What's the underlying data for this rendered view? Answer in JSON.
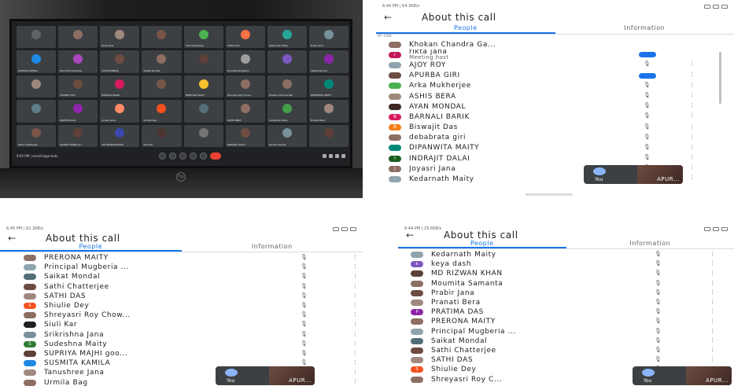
{
  "laptop": {
    "tiles": [
      {
        "name": "",
        "color": "#5f6368"
      },
      {
        "name": "",
        "color": "#8d6e63"
      },
      {
        "name": "Rikta Jana",
        "color": "#a1887f"
      },
      {
        "name": "",
        "color": "#795548"
      },
      {
        "name": "Arka Mukherjee",
        "color": "#4caf50"
      },
      {
        "name": "SATHI DAS",
        "color": "#ff7043"
      },
      {
        "name": "Kedarnath Maity",
        "color": "#26a69a"
      },
      {
        "name": "Prabir Jana",
        "color": "#78909c"
      },
      {
        "name": "SUSMITA KAMILA",
        "color": "#1e88e5"
      },
      {
        "name": "Moumita Samanta",
        "color": "#ab47bc"
      },
      {
        "name": "AYAN MONDAL",
        "color": "#6d4c41"
      },
      {
        "name": "Saikat Mondal",
        "color": "#8d6e63"
      },
      {
        "name": "",
        "color": "#5d4037"
      },
      {
        "name": "Principal Mugberia",
        "color": "#9e9e9e"
      },
      {
        "name": "",
        "color": "#7e57c2"
      },
      {
        "name": "debabrata giri",
        "color": "#8e24aa"
      },
      {
        "name": "",
        "color": "#a1887f"
      },
      {
        "name": "TONMOY DEY",
        "color": "#6d4c41"
      },
      {
        "name": "BARNALI BARIK",
        "color": "#d81b60"
      },
      {
        "name": "",
        "color": "#795548"
      },
      {
        "name": "PRERONA MAITY",
        "color": "#fbc02d"
      },
      {
        "name": "Shreyasri Roy Chow...",
        "color": "#8d6e63"
      },
      {
        "name": "Khokan Chandra Ba...",
        "color": "#8d6e63"
      },
      {
        "name": "DIPANWITA MAITY",
        "color": "#00897b"
      },
      {
        "name": "",
        "color": "#607d8b"
      },
      {
        "name": "PRATIMA DAS",
        "color": "#8e24aa"
      },
      {
        "name": "Joyasri Jana",
        "color": "#ff8a65"
      },
      {
        "name": "Shiulie Dey",
        "color": "#f4511e"
      },
      {
        "name": "",
        "color": "#546e7a"
      },
      {
        "name": "ASHIS BERA",
        "color": "#8d6e63"
      },
      {
        "name": "Sudeshna Maity",
        "color": "#43a047"
      },
      {
        "name": "Pranati Bera",
        "color": "#a1887f"
      },
      {
        "name": "Sathi Chatterjee",
        "color": "#795548"
      },
      {
        "name": "SUPRIYA MAJHI go...",
        "color": "#5d4037"
      },
      {
        "name": "MD RIZWAN KHAN",
        "color": "#3949ab"
      },
      {
        "name": "Siuli Kar",
        "color": "#4e342e"
      },
      {
        "name": "",
        "color": "#757575"
      },
      {
        "name": "INDRAJIT DALAI",
        "color": "#6d4c41"
      },
      {
        "name": "Tanusri Manna",
        "color": "#78909c"
      },
      {
        "name": "",
        "color": "#5d4037"
      }
    ],
    "time": "9:05 PM | email-kaga-todo",
    "brand": "hp"
  },
  "panel_a": {
    "status_time": "6:44 PM | 64.3KB/s",
    "title": "About this call",
    "tab_people": "People",
    "tab_info": "Information",
    "section": "In call",
    "rows": [
      {
        "name": "Khokan Chandra Ga...",
        "sub": "",
        "color": "#8d6e63",
        "letter": ""
      },
      {
        "name": "rikta jana",
        "sub": "Meeting host",
        "color": "#c2185b",
        "letter": "r"
      },
      {
        "name": "AJOY ROY",
        "sub": "",
        "color": "#90a4ae",
        "letter": ""
      },
      {
        "name": "APURBA GIRI",
        "sub": "",
        "color": "#6d4c41",
        "letter": ""
      },
      {
        "name": "Arka Mukherjee",
        "sub": "",
        "color": "#4caf50",
        "letter": ""
      },
      {
        "name": "ASHIS BERA",
        "sub": "",
        "color": "#a1887f",
        "letter": ""
      },
      {
        "name": "AYAN MONDAL",
        "sub": "",
        "color": "#3e2723",
        "letter": ""
      },
      {
        "name": "BARNALI BARIK",
        "sub": "",
        "color": "#d81b60",
        "letter": "B"
      },
      {
        "name": "Biswajit Das",
        "sub": "",
        "color": "#f57f17",
        "letter": "B"
      },
      {
        "name": "debabrata giri",
        "sub": "",
        "color": "#8d6e63",
        "letter": ""
      },
      {
        "name": "DIPANWITA MAITY",
        "sub": "",
        "color": "#00897b",
        "letter": ""
      },
      {
        "name": "INDRAJIT DALAI",
        "sub": "",
        "color": "#1b5e20",
        "letter": "I"
      },
      {
        "name": "Joyasri Jana",
        "sub": "",
        "color": "#8d6e63",
        "letter": "J"
      },
      {
        "name": "Kedarnath Maity",
        "sub": "",
        "color": "#90a4ae",
        "letter": ""
      }
    ],
    "you_label": "You",
    "other_label": "APUR..."
  },
  "panel_b": {
    "status_time": "6:45 PM | 62.2KB/s",
    "title": "About this call",
    "tab_people": "People",
    "tab_info": "Information",
    "rows": [
      {
        "name": "PRERONA MAITY",
        "color": "#8d6e63",
        "letter": ""
      },
      {
        "name": "Principal Mugberia ...",
        "color": "#90a4ae",
        "letter": ""
      },
      {
        "name": "Saikat Mondal",
        "color": "#546e7a",
        "letter": ""
      },
      {
        "name": "Sathi Chatterjee",
        "color": "#6d4c41",
        "letter": ""
      },
      {
        "name": "SATHI DAS",
        "color": "#a1887f",
        "letter": ""
      },
      {
        "name": "Shiulie Dey",
        "color": "#f4511e",
        "letter": "S"
      },
      {
        "name": "Shreyasri Roy Chow...",
        "color": "#8d6e63",
        "letter": ""
      },
      {
        "name": "Siuli Kar",
        "color": "#212121",
        "letter": ""
      },
      {
        "name": "Srikrishna Jana",
        "color": "#78909c",
        "letter": ""
      },
      {
        "name": "Sudeshna Maity",
        "color": "#2e7d32",
        "letter": "S"
      },
      {
        "name": "SUPRIYA MAJHI goo...",
        "color": "#5d4037",
        "letter": ""
      },
      {
        "name": "SUSMITA KAMILA",
        "color": "#1e88e5",
        "letter": ""
      },
      {
        "name": "Tanushree Jana",
        "color": "#a1887f",
        "letter": ""
      },
      {
        "name": "Urmila Bag",
        "color": "#8d6e63",
        "letter": ""
      }
    ],
    "you_label": "You",
    "other_label": "APUR..."
  },
  "panel_c": {
    "status_time": "6:44 PM | 29.6KB/s",
    "title": "About this call",
    "tab_people": "People",
    "tab_info": "Information",
    "rows": [
      {
        "name": "Kedarnath Maity",
        "color": "#90a4ae",
        "letter": ""
      },
      {
        "name": "keya dash",
        "color": "#7e57c2",
        "letter": "k"
      },
      {
        "name": "MD RIZWAN KHAN",
        "color": "#5d4037",
        "letter": ""
      },
      {
        "name": "Moumita Samanta",
        "color": "#8d6e63",
        "letter": ""
      },
      {
        "name": "Prabir Jana",
        "color": "#6d4c41",
        "letter": ""
      },
      {
        "name": "Pranati Bera",
        "color": "#a1887f",
        "letter": ""
      },
      {
        "name": "PRATIMA DAS",
        "color": "#8e24aa",
        "letter": "P"
      },
      {
        "name": "PRERONA MAITY",
        "color": "#8d6e63",
        "letter": ""
      },
      {
        "name": "Principal Mugberia ...",
        "color": "#90a4ae",
        "letter": ""
      },
      {
        "name": "Saikat Mondal",
        "color": "#546e7a",
        "letter": ""
      },
      {
        "name": "Sathi Chatterjee",
        "color": "#6d4c41",
        "letter": ""
      },
      {
        "name": "SATHI DAS",
        "color": "#a1887f",
        "letter": ""
      },
      {
        "name": "Shiulie Dey",
        "color": "#f4511e",
        "letter": "S"
      },
      {
        "name": "Shreyasri Roy C...",
        "color": "#8d6e63",
        "letter": ""
      }
    ],
    "you_label": "You",
    "other_label": "APUR..."
  },
  "icons": {
    "back": "back-arrow-icon",
    "mic": "mic-off-icon",
    "more": "more-vert-icon"
  }
}
